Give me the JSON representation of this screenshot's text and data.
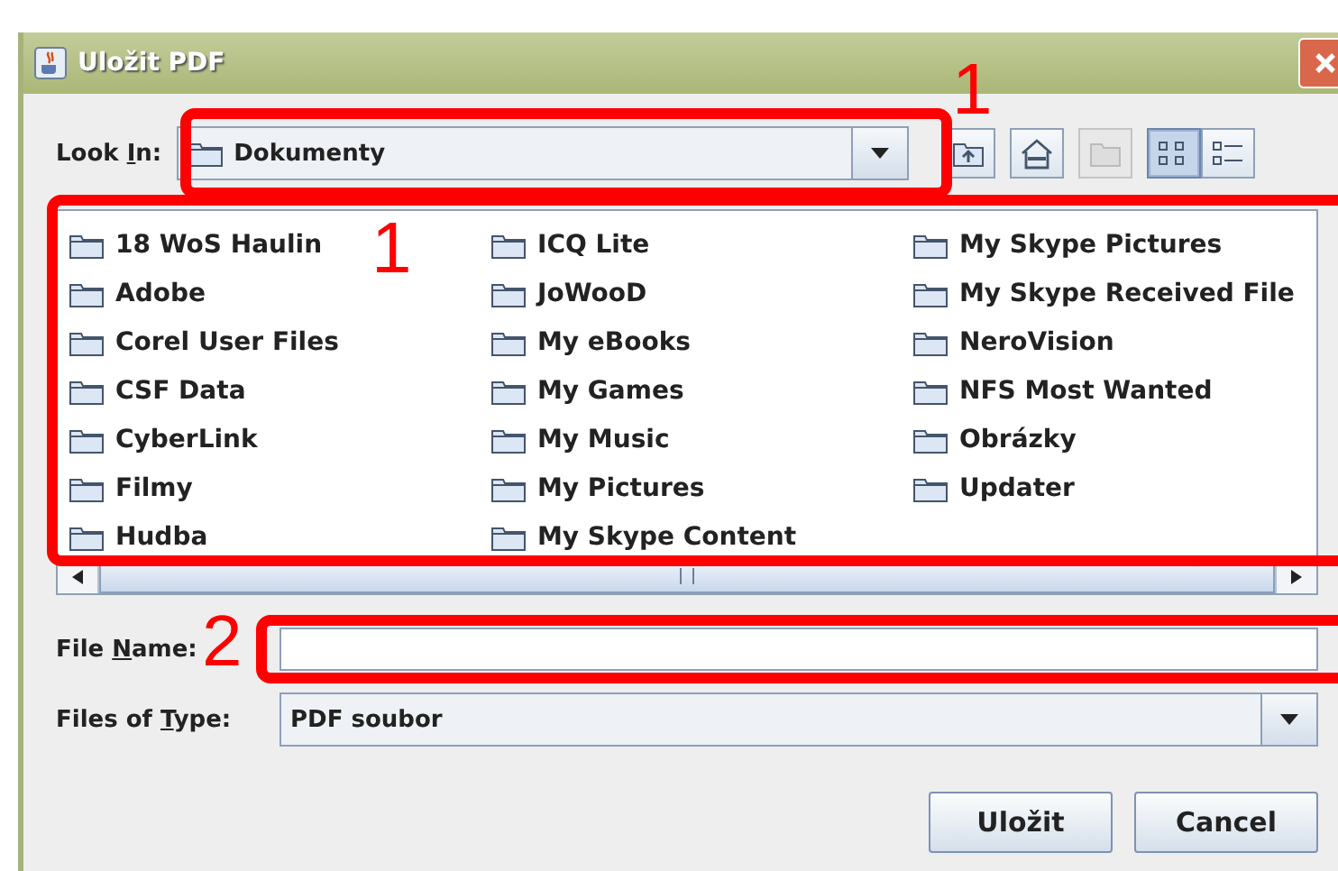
{
  "window": {
    "title": "Uložit PDF"
  },
  "look_in": {
    "label": {
      "before": "Look ",
      "key": "I",
      "after": "n:"
    },
    "value": "Dokumenty"
  },
  "toolbar_buttons": [
    {
      "kind": "up",
      "disabled": false,
      "selected": false
    },
    {
      "kind": "home",
      "disabled": false,
      "selected": false
    },
    {
      "kind": "newfolder",
      "disabled": true,
      "selected": false
    },
    {
      "kind": "list",
      "disabled": false,
      "selected": true
    },
    {
      "kind": "details",
      "disabled": false,
      "selected": false
    }
  ],
  "files": [
    {
      "name": "18 WoS Haulin"
    },
    {
      "name": "Adobe"
    },
    {
      "name": "Corel User Files"
    },
    {
      "name": "CSF Data"
    },
    {
      "name": "CyberLink"
    },
    {
      "name": "Filmy"
    },
    {
      "name": "Hudba"
    },
    {
      "name": "ICQ Lite"
    },
    {
      "name": "JoWooD"
    },
    {
      "name": "My eBooks"
    },
    {
      "name": "My Games"
    },
    {
      "name": "My Music"
    },
    {
      "name": "My Pictures"
    },
    {
      "name": "My Skype Content"
    },
    {
      "name": "My Skype Pictures"
    },
    {
      "name": "My Skype Received File"
    },
    {
      "name": "NeroVision"
    },
    {
      "name": "NFS Most Wanted"
    },
    {
      "name": "Obrázky"
    },
    {
      "name": "Updater"
    }
  ],
  "file_name": {
    "label": {
      "before": "File ",
      "key": "N",
      "after": "ame:"
    }
  },
  "file_type": {
    "label": {
      "before": "Files of ",
      "key": "T",
      "after": "ype:"
    },
    "value": "PDF soubor"
  },
  "buttons": [
    "Uložit",
    "Cancel"
  ],
  "annotations": [
    {
      "kind": "combo",
      "number": "1"
    },
    {
      "kind": "list",
      "number": "1"
    },
    {
      "kind": "name",
      "number": "2"
    }
  ]
}
